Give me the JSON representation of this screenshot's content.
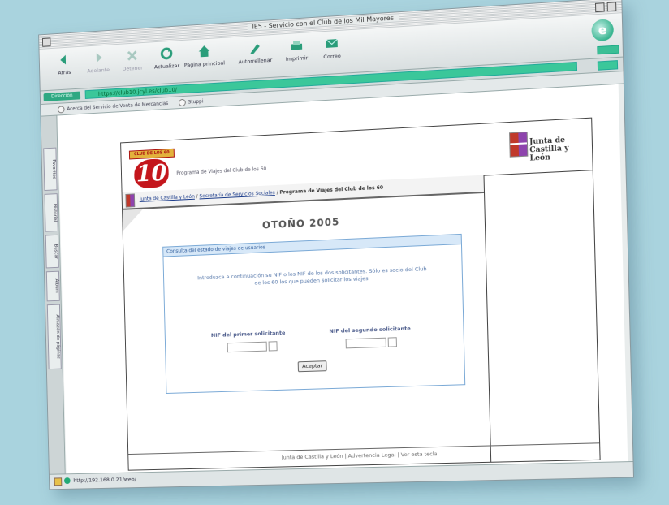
{
  "window": {
    "title": "IE5 - Servicio con el Club de los Mil Mayores"
  },
  "toolbar": {
    "back": "Atrás",
    "forward": "Adelante",
    "stop": "Detener",
    "refresh": "Actualizar",
    "home": "Página principal",
    "autofill": "Autorrellenar",
    "print": "Imprimir",
    "mail": "Correo"
  },
  "address": {
    "label": "Dirección",
    "url": "https://club10.jcyl.es/club10/"
  },
  "links": {
    "item1": "Acerca del Servicio de Venta de Mercancías",
    "item2": "Stuppi"
  },
  "explorer_tabs": [
    "Favoritos",
    "Historial",
    "Buscar",
    "Álbum",
    "Almacén de páginas"
  ],
  "page": {
    "stamp_banner": "CLUB DE LOS 60",
    "logo_text": "10",
    "program_caption": "Programa de Viajes del Club de los 60",
    "jcyl_line1": "Junta de",
    "jcyl_line2": "Castilla y León",
    "breadcrumb": {
      "link1": "Junta de Castilla y León",
      "sep": " / ",
      "link2": "Secretaría de Servicios Sociales",
      "current": "Programa de Viajes del Club de los 60"
    },
    "season_title": "OTOÑO 2005",
    "form": {
      "title": "Consulta del estado de viajes de usuarios",
      "instructions": "Introduzca a continuación su NIF o los NIF de los dos solicitantes. Sólo es socio del Club de los 60 los que pueden solicitar los viajes",
      "label_first": "NIF del primer solicitante",
      "label_second": "NIF del segundo solicitante",
      "accept": "Aceptar"
    },
    "footer": "Junta de Castilla y León | Advertencia Legal | Ver esta tecla"
  },
  "status": {
    "url": "http://192.168.0.21/web/"
  },
  "colors": {
    "background": "#a9d3de",
    "accent_green": "#3bc79a",
    "form_border": "#7aa9d6",
    "logo_red": "#c4161c"
  }
}
